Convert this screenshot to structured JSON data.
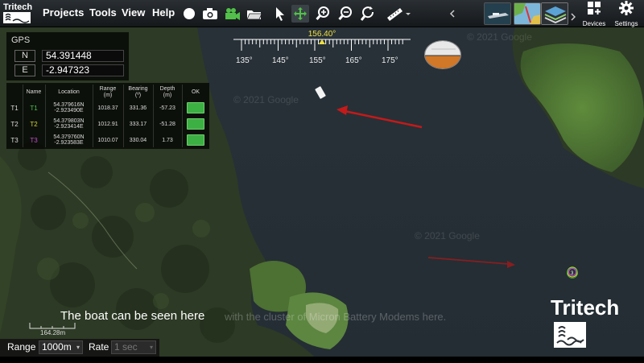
{
  "app": {
    "logo_text": "Tritech",
    "menus": [
      "Projects",
      "Tools",
      "View",
      "Help"
    ],
    "right_buttons": [
      {
        "label": "Devices",
        "icon": "grid-plus-icon"
      },
      {
        "label": "Settings",
        "icon": "gear-icon"
      }
    ]
  },
  "gps": {
    "title": "GPS",
    "rows": [
      {
        "key": "N",
        "value": "54.391448"
      },
      {
        "key": "E",
        "value": "-2.947323"
      }
    ]
  },
  "modems": {
    "headers": [
      "Name",
      "Location",
      "Range\n(m)",
      "Bearing\n(º)",
      "Depth\n(m)",
      "OK"
    ],
    "rows": [
      {
        "id": "T1",
        "name": "T1",
        "loc1": "54.379616N",
        "loc2": "-2.923490E",
        "range": "1018.37",
        "bearing": "331.36",
        "depth": "-57.23",
        "name_color": "#4cc44c"
      },
      {
        "id": "T2",
        "name": "T2",
        "loc1": "54.379803N",
        "loc2": "-2.923414E",
        "range": "1012.91",
        "bearing": "333.17",
        "depth": "-51.28",
        "name_color": "#d8d830"
      },
      {
        "id": "T3",
        "name": "T3",
        "loc1": "54.379760N",
        "loc2": "-2.923583E",
        "range": "1010.07",
        "bearing": "330.04",
        "depth": "1.73",
        "name_color": "#c050c8"
      }
    ]
  },
  "compass": {
    "heading": "156.40°",
    "ticks": [
      "135°",
      "145°",
      "155°",
      "165°",
      "175°"
    ]
  },
  "map": {
    "watermark": "© 2021 Google",
    "target_marker": "3",
    "caption_main": "The boat can be seen here",
    "caption_faded": "with the cluster of Micron Battery Modems here.",
    "scale_label": "164.28m"
  },
  "bottombar": {
    "range_label": "Range",
    "range_value": "1000m",
    "rate_label": "Rate",
    "rate_value": "1 sec"
  },
  "brand": {
    "word": "Tritech"
  },
  "colors": {
    "arrow": "#c41a1a",
    "ok_green": "#3cb043",
    "heading": "#f0e040"
  }
}
